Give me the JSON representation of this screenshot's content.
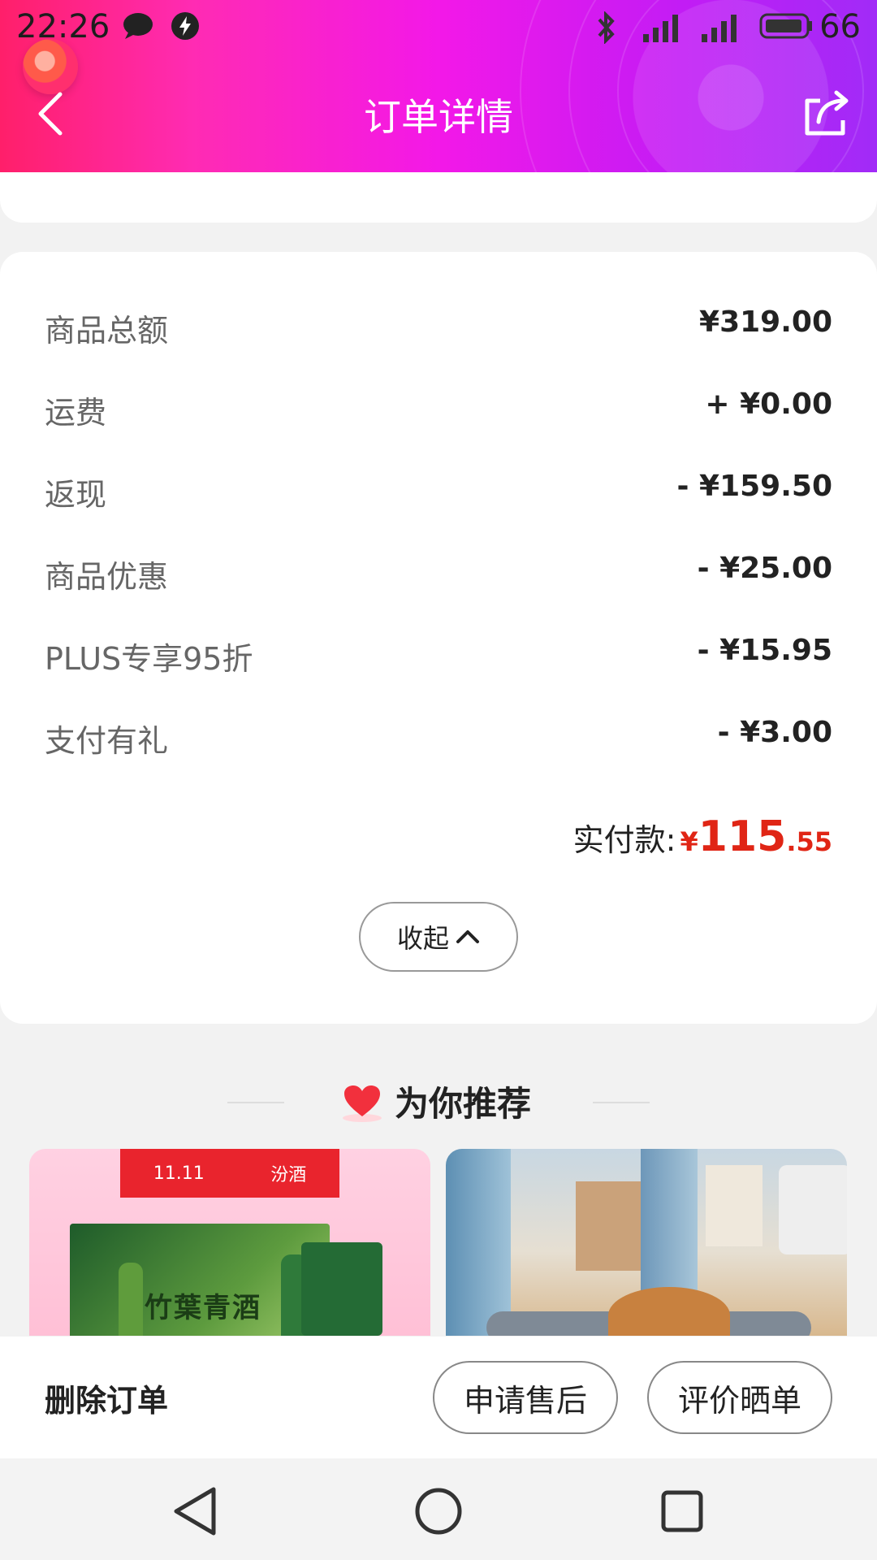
{
  "status_bar": {
    "time": "22:26",
    "battery_level": "66",
    "icons": [
      "chat-bubble-icon",
      "bolt-badge-icon",
      "bluetooth-icon",
      "signal-icon",
      "signal-4g-icon",
      "battery-icon"
    ]
  },
  "header": {
    "title": "订单详情",
    "colors": {
      "start": "#ff1f6a",
      "mid": "#f318e8",
      "end": "#a12bf7"
    }
  },
  "summary": {
    "rows": [
      {
        "label": "商品总额",
        "value": "¥319.00"
      },
      {
        "label": "运费",
        "value": "+ ¥0.00"
      },
      {
        "label": "返现",
        "value": "- ¥159.50"
      },
      {
        "label": "商品优惠",
        "value": "- ¥25.00"
      },
      {
        "label": "PLUS专享95折",
        "value": "- ¥15.95"
      },
      {
        "label": "支付有礼",
        "value": "- ¥3.00"
      }
    ],
    "paid_label": "实付款:",
    "paid_currency": "¥",
    "paid_integer": "115",
    "paid_decimal": ".55",
    "collapse_label": "收起",
    "accent": "#e02515"
  },
  "recommend": {
    "title": "为你推荐",
    "products": [
      {
        "banner_left": "11.11",
        "banner_right": "汾酒",
        "name": "竹葉青酒"
      },
      {
        "name": ""
      }
    ]
  },
  "action_bar": {
    "delete_label": "删除订单",
    "after_sales_label": "申请售后",
    "review_label": "评价晒单"
  },
  "navbar": {
    "icons": [
      "back-triangle-icon",
      "home-circle-icon",
      "recents-square-icon"
    ]
  }
}
